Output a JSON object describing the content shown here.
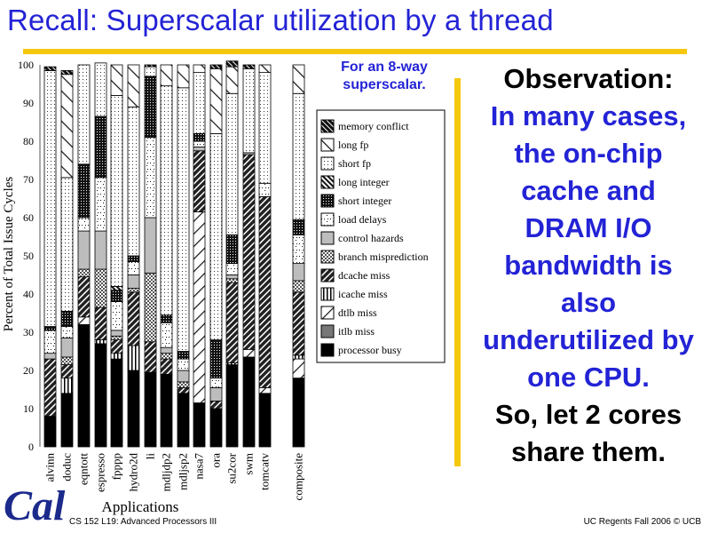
{
  "slide": {
    "title": "Recall: Superscalar utilization by a thread",
    "subnote_line1": "For an 8-way",
    "subnote_line2": "superscalar.",
    "observation": {
      "heading": "Observation:",
      "blue_lines": [
        "In many cases,",
        "the on-chip",
        "cache and",
        "DRAM I/O",
        "bandwidth is",
        "also",
        "underutilized by",
        "one CPU."
      ],
      "black_lines": [
        "So, let 2 cores",
        "share them."
      ]
    },
    "footer_left": "CS 152 L19: Advanced Processors III",
    "footer_right": "UC Regents Fall 2006 © UCB",
    "logo_text": "Cal",
    "colors": {
      "title_blue": "#2323d6",
      "accent_gold": "#f5c80f",
      "logo_blue": "#1c2a8c"
    }
  },
  "chart_data": {
    "type": "bar",
    "stacked": true,
    "title": "",
    "xlabel": "Applications",
    "ylabel": "Percent of Total Issue Cycles",
    "ylim": [
      0,
      100
    ],
    "yticks": [
      0,
      10,
      20,
      30,
      40,
      50,
      60,
      70,
      80,
      90,
      100
    ],
    "grid": false,
    "legend_position": "right",
    "categories": [
      "alvinn",
      "doduc",
      "eqntott",
      "espresso",
      "fpppp",
      "hydro2d",
      "li",
      "mdljdp2",
      "mdljsp2",
      "nasa7",
      "ora",
      "su2cor",
      "swm",
      "tomcatv",
      "composite"
    ],
    "series": [
      {
        "name": "processor busy",
        "pattern": "solid-black",
        "values": [
          8,
          14,
          32,
          27,
          23,
          20,
          19.5,
          19,
          14,
          11.5,
          10,
          21.5,
          23.5,
          14,
          18
        ]
      },
      {
        "name": "itlb miss",
        "pattern": "solid-darkgray",
        "values": [
          0,
          0,
          0,
          0,
          0,
          0,
          0,
          0,
          0,
          0,
          0,
          0,
          0,
          0,
          0
        ]
      },
      {
        "name": "dtlb miss",
        "pattern": "sparse-diagonal-back",
        "values": [
          0,
          0,
          2,
          0,
          0,
          0,
          0,
          0,
          0,
          50,
          0,
          0,
          2,
          1.5,
          5
        ]
      },
      {
        "name": "icache miss",
        "pattern": "vertical-lines",
        "values": [
          0,
          4,
          0,
          1,
          1.5,
          6.5,
          0,
          0,
          0,
          0,
          0,
          0.5,
          0,
          0,
          1
        ]
      },
      {
        "name": "dcache miss",
        "pattern": "dense-diagonal-back",
        "values": [
          15,
          3.5,
          10.5,
          8.5,
          3.5,
          14,
          8,
          4,
          1.5,
          16,
          2,
          21,
          51,
          50,
          16.5
        ]
      },
      {
        "name": "branch misprediction",
        "pattern": "crosshatch",
        "values": [
          0,
          2,
          2,
          10,
          1,
          1,
          18,
          1.5,
          1.5,
          0,
          0,
          1,
          0,
          0,
          3
        ]
      },
      {
        "name": "control hazards",
        "pattern": "solid-lightgray",
        "values": [
          1.5,
          5,
          10,
          10,
          1.5,
          3.5,
          14.5,
          1.5,
          3,
          1,
          3.5,
          1,
          0.5,
          0,
          4.5
        ]
      },
      {
        "name": "load delays",
        "pattern": "sparse-dots",
        "values": [
          6,
          3,
          3.5,
          14,
          7.5,
          3.5,
          21,
          6.5,
          3,
          1.5,
          2.5,
          3,
          0,
          3.5,
          7.5
        ]
      },
      {
        "name": "short integer",
        "pattern": "dense-grid",
        "values": [
          1,
          4,
          14,
          16,
          3,
          1.5,
          16,
          2,
          2,
          2,
          10,
          7.5,
          0,
          0,
          4
        ]
      },
      {
        "name": "long integer",
        "pattern": "dense-diagonal-fwd",
        "values": [
          0,
          0,
          0,
          0,
          1,
          0,
          0,
          0,
          0,
          0,
          0,
          0,
          0,
          0,
          0
        ]
      },
      {
        "name": "short fp",
        "pattern": "fine-dots",
        "values": [
          67,
          35,
          26,
          14,
          50,
          39,
          2.5,
          60,
          69,
          16,
          54,
          37,
          22,
          29,
          33
        ]
      },
      {
        "name": "long fp",
        "pattern": "sparse-diagonal-fwd",
        "values": [
          0,
          27,
          0,
          0,
          8,
          11,
          0,
          5.5,
          6,
          2,
          17,
          7,
          0,
          2,
          7.5
        ]
      },
      {
        "name": "memory conflict",
        "pattern": "dark-diagonal-fwd",
        "values": [
          1,
          1,
          0,
          0,
          0,
          0,
          0.5,
          0,
          0,
          0,
          1,
          1.5,
          1,
          0,
          0
        ]
      }
    ],
    "legend_order": [
      "memory conflict",
      "long fp",
      "short fp",
      "long integer",
      "short integer",
      "load delays",
      "control hazards",
      "branch misprediction",
      "dcache miss",
      "icache miss",
      "dtlb miss",
      "itlb miss",
      "processor busy"
    ]
  }
}
